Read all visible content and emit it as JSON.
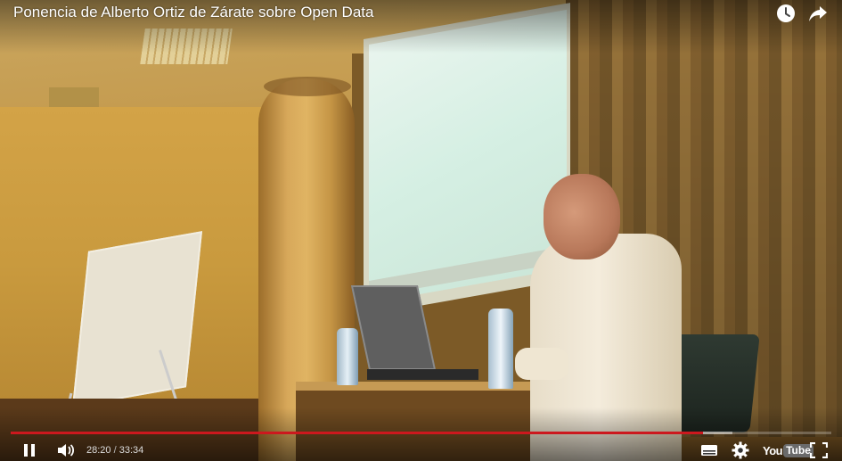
{
  "player": {
    "title": "Ponencia de Alberto Ortiz de Zárate sobre Open Data",
    "time": {
      "current": "28:20",
      "separator": "/",
      "duration": "33:34"
    },
    "progress": {
      "played_fraction": 0.844,
      "buffered_fraction": 0.88
    },
    "logo": {
      "you": "You",
      "tube": "Tube"
    },
    "icons": {
      "watch_later": "clock-icon",
      "share": "share-arrow-icon",
      "play_pause": "pause-icon",
      "volume": "volume-icon",
      "captions": "captions-icon",
      "settings": "gear-icon",
      "fullscreen": "fullscreen-icon"
    },
    "colors": {
      "progress_played": "#cc181e",
      "control_icons": "#ffffff"
    }
  }
}
